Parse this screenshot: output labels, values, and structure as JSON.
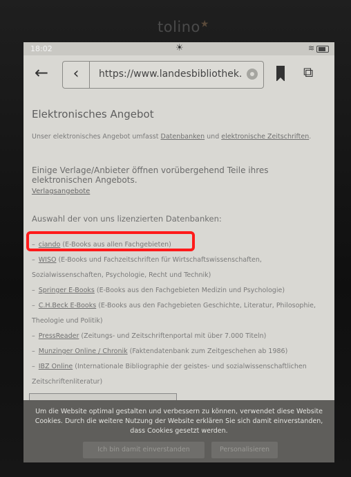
{
  "device": {
    "brand": "tolino"
  },
  "status": {
    "time": "18:02"
  },
  "browser": {
    "url": "https://www.landesbibliothek."
  },
  "page": {
    "heading": "Elektronisches Angebot",
    "intro": {
      "before": "Unser elektronisches Angebot umfasst ",
      "link1": "Datenbanken",
      "middle": " und ",
      "link2": "elektronische Zeitschriften",
      "after": "."
    },
    "notice": "Einige Verlage/Anbieter öffnen vorübergehend Teile ihres elektronischen Angebots.",
    "verlag_link": "Verlagsangebote",
    "auswahl": "Auswahl der von uns lizenzierten Datenbanken:",
    "items": [
      {
        "link": "ciando",
        "desc": " (E-Books aus allen Fachgebieten)"
      },
      {
        "link": "WISO",
        "desc": " (E-Books und Fachzeitschriften für Wirtschaftswissenschaften,",
        "cont": "Sozialwissenschaften, Psychologie, Recht und Technik)"
      },
      {
        "link": "Springer E-Books",
        "desc": " (E-Books aus den Fachgebieten Medizin und Psychologie)"
      },
      {
        "link": "C.H.Beck E-Books",
        "desc": " (E-Books aus den Fachgebieten Geschichte, Literatur, Philosophie,",
        "cont": "Theologie und Politik)"
      },
      {
        "link": "PressReader",
        "desc": " (Zeitungs- und Zeitschriftenportal mit über 7.000 Titeln)"
      },
      {
        "link": "Munzinger Online / Chronik",
        "desc": " (Faktendatenbank zum Zeitgeschehen ab 1986)"
      },
      {
        "link": "IBZ Online",
        "desc": " (Internationale Bibliographie der geistes- und sozialwissenschaftlichen",
        "cont": "Zeitschriftenliteratur)"
      }
    ]
  },
  "cookie": {
    "text": "Um die Website optimal gestalten und verbessern zu können, verwendet diese Website Cookies. Durch die weitere Nutzung der Website erklären Sie sich damit einverstanden, dass Cookies gesetzt werden.",
    "accept": "Ich bin damit einverstanden",
    "personalize": "Personalisieren"
  }
}
